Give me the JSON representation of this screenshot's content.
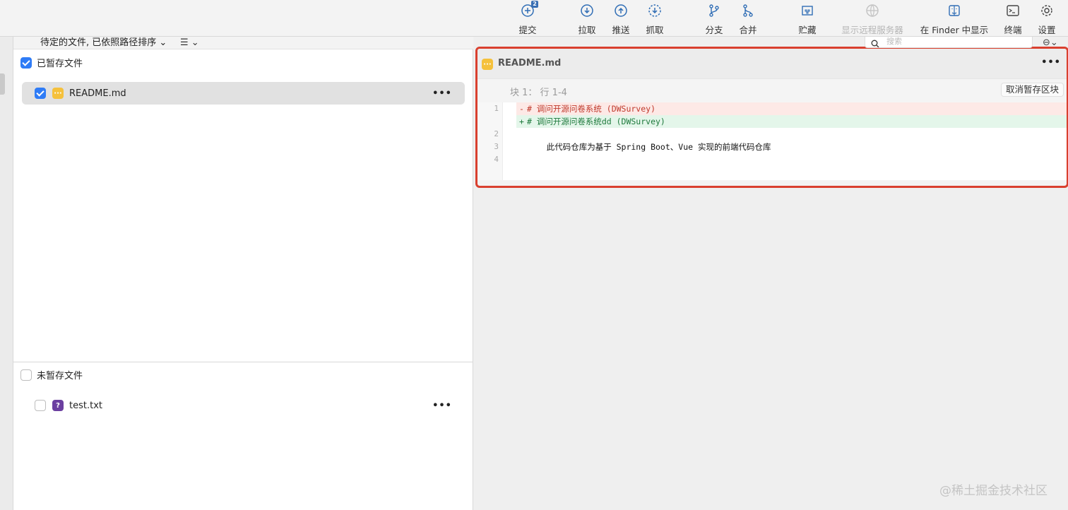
{
  "toolbar": {
    "commit": {
      "label": "提交",
      "badge": "2"
    },
    "pull": {
      "label": "拉取"
    },
    "push": {
      "label": "推送"
    },
    "fetch": {
      "label": "抓取"
    },
    "branch": {
      "label": "分支"
    },
    "merge": {
      "label": "合并"
    },
    "stash": {
      "label": "贮藏"
    },
    "remote": {
      "label": "显示远程服务器"
    },
    "finder": {
      "label": "在 Finder 中显示"
    },
    "terminal": {
      "label": "终端"
    },
    "settings": {
      "label": "设置"
    }
  },
  "search": {
    "placeholder": "搜索"
  },
  "sort_bar": {
    "label": "待定的文件, 已依照路径排序"
  },
  "staged": {
    "title": "已暂存文件",
    "checked": true,
    "files": [
      {
        "name": "README.md",
        "status": "modified",
        "checked": true,
        "more": "•••"
      }
    ]
  },
  "unstaged": {
    "title": "未暂存文件",
    "checked": false,
    "files": [
      {
        "name": "test.txt",
        "status": "untracked",
        "checked": false,
        "more": "•••",
        "icon_glyph": "?"
      }
    ]
  },
  "diff": {
    "file": "README.md",
    "more": "•••",
    "hunk_label": "块 1：  行 1-4",
    "unstage_hunk": "取消暂存区块",
    "lines": [
      {
        "ln": "1",
        "type": "del",
        "mark": "-",
        "text": "# 调问开源问卷系统 (DWSurvey)"
      },
      {
        "ln": "",
        "type": "add",
        "mark": "+",
        "text": "# 调问开源问卷系统dd (DWSurvey)"
      },
      {
        "ln": "2",
        "type": "ctx",
        "mark": "",
        "text": ""
      },
      {
        "ln": "3",
        "type": "ctx",
        "mark": "",
        "text": "    此代码仓库为基于 Spring Boot、Vue 实现的前端代码仓库"
      },
      {
        "ln": "4",
        "type": "ctx",
        "mark": "",
        "text": ""
      }
    ]
  },
  "watermark": "@稀土掘金技术社区",
  "colors": {
    "accent": "#2f7cf6",
    "highlight_border": "#d9402f",
    "modified": "#f5c13c",
    "untracked": "#6b3fa0"
  }
}
